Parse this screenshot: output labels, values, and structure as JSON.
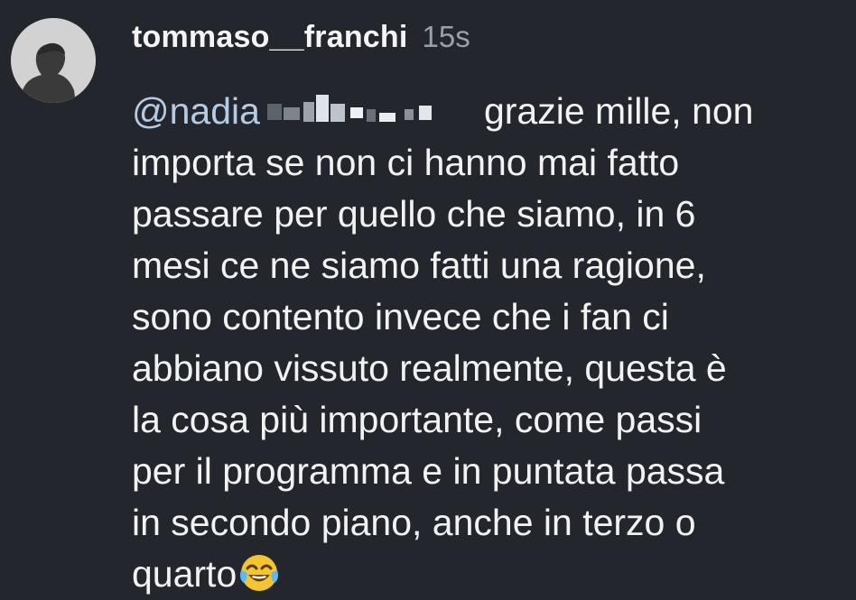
{
  "comment": {
    "username": "tommaso__franchi",
    "timestamp": "15s",
    "mention": "@nadia",
    "lines": [
      "grazie mille, non",
      "importa se non ci hanno mai fatto",
      "passare per quello che siamo, in 6",
      "mesi ce ne siamo fatti una ragione,",
      "sono contento invece che i fan ci",
      "abbiano vissuto realmente, questa è",
      "la cosa più importante, come passi",
      "per il programma e in puntata passa",
      "in secondo piano, anche in terzo o",
      "quarto"
    ],
    "emoji": "face-with-tears-of-joy"
  },
  "colors": {
    "background": "#23262c",
    "text": "#f2f2f2",
    "mention": "#b4cbe4",
    "timestamp": "#9aa0a8"
  }
}
